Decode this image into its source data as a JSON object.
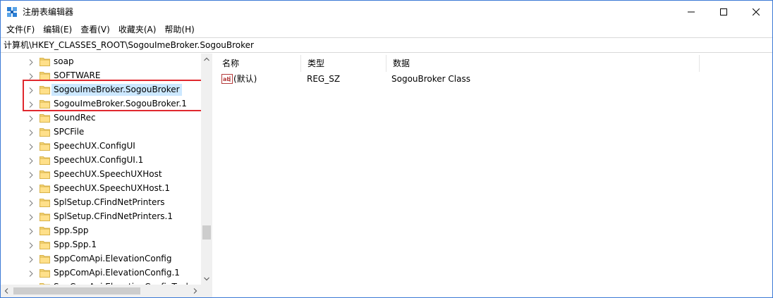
{
  "window": {
    "title": "注册表编辑器",
    "accent": "#3c7ad6"
  },
  "menu": [
    {
      "label": "文件(F)"
    },
    {
      "label": "编辑(E)"
    },
    {
      "label": "查看(V)"
    },
    {
      "label": "收藏夹(A)"
    },
    {
      "label": "帮助(H)"
    }
  ],
  "address": {
    "path": "计算机\\HKEY_CLASSES_ROOT\\SogouImeBroker.SogouBroker"
  },
  "tree": {
    "items": [
      {
        "label": "soap",
        "selected": false
      },
      {
        "label": "SOFTWARE",
        "selected": false
      },
      {
        "label": "SogouImeBroker.SogouBroker",
        "selected": true
      },
      {
        "label": "SogouImeBroker.SogouBroker.1",
        "selected": false
      },
      {
        "label": "SoundRec",
        "selected": false
      },
      {
        "label": "SPCFile",
        "selected": false
      },
      {
        "label": "SpeechUX.ConfigUI",
        "selected": false
      },
      {
        "label": "SpeechUX.ConfigUI.1",
        "selected": false
      },
      {
        "label": "SpeechUX.SpeechUXHost",
        "selected": false
      },
      {
        "label": "SpeechUX.SpeechUXHost.1",
        "selected": false
      },
      {
        "label": "SplSetup.CFindNetPrinters",
        "selected": false
      },
      {
        "label": "SplSetup.CFindNetPrinters.1",
        "selected": false
      },
      {
        "label": "Spp.Spp",
        "selected": false
      },
      {
        "label": "Spp.Spp.1",
        "selected": false
      },
      {
        "label": "SppComApi.ElevationConfig",
        "selected": false
      },
      {
        "label": "SppComApi.ElevationConfig.1",
        "selected": false
      },
      {
        "label": "SppComApi.ElevationConfigTool",
        "selected": false
      }
    ],
    "highlight_color": "#e0282e",
    "selection_color": "#cce8ff"
  },
  "values": {
    "columns": {
      "name": "名称",
      "type": "类型",
      "data": "数据"
    },
    "rows": [
      {
        "name": "(默认)",
        "type": "REG_SZ",
        "data": "SogouBroker Class",
        "icon": "string-value-icon"
      }
    ]
  }
}
